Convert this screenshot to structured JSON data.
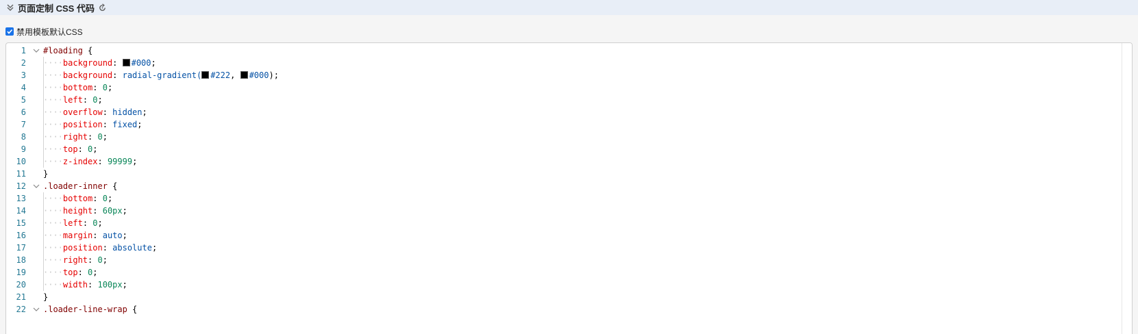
{
  "header": {
    "title": "页面定制 CSS 代码"
  },
  "options": {
    "disable_template_css_label": "禁用模板默认CSS",
    "disable_template_css_checked": true
  },
  "editor": {
    "lines": [
      {
        "n": "1",
        "fold": true,
        "indent": false,
        "tokens": [
          {
            "t": "#loading",
            "c": "sel"
          },
          {
            "t": " {",
            "c": "brace"
          }
        ]
      },
      {
        "n": "2",
        "fold": false,
        "indent": true,
        "tokens": [
          {
            "t": "background",
            "c": "prop"
          },
          {
            "t": ": ",
            "c": "punct"
          },
          {
            "t": "",
            "c": "swatch"
          },
          {
            "t": "#000",
            "c": "val-kw"
          },
          {
            "t": ";",
            "c": "punct"
          }
        ]
      },
      {
        "n": "3",
        "fold": false,
        "indent": true,
        "tokens": [
          {
            "t": "background",
            "c": "prop"
          },
          {
            "t": ": ",
            "c": "punct"
          },
          {
            "t": "radial-gradient(",
            "c": "val-kw"
          },
          {
            "t": "",
            "c": "swatch"
          },
          {
            "t": "#222",
            "c": "val-kw"
          },
          {
            "t": ", ",
            "c": "punct"
          },
          {
            "t": "",
            "c": "swatch"
          },
          {
            "t": "#000",
            "c": "val-kw"
          },
          {
            "t": ");",
            "c": "punct"
          }
        ]
      },
      {
        "n": "4",
        "fold": false,
        "indent": true,
        "tokens": [
          {
            "t": "bottom",
            "c": "prop"
          },
          {
            "t": ": ",
            "c": "punct"
          },
          {
            "t": "0",
            "c": "val-num"
          },
          {
            "t": ";",
            "c": "punct"
          }
        ]
      },
      {
        "n": "5",
        "fold": false,
        "indent": true,
        "tokens": [
          {
            "t": "left",
            "c": "prop"
          },
          {
            "t": ": ",
            "c": "punct"
          },
          {
            "t": "0",
            "c": "val-num"
          },
          {
            "t": ";",
            "c": "punct"
          }
        ]
      },
      {
        "n": "6",
        "fold": false,
        "indent": true,
        "tokens": [
          {
            "t": "overflow",
            "c": "prop"
          },
          {
            "t": ": ",
            "c": "punct"
          },
          {
            "t": "hidden",
            "c": "val-kw"
          },
          {
            "t": ";",
            "c": "punct"
          }
        ]
      },
      {
        "n": "7",
        "fold": false,
        "indent": true,
        "tokens": [
          {
            "t": "position",
            "c": "prop"
          },
          {
            "t": ": ",
            "c": "punct"
          },
          {
            "t": "fixed",
            "c": "val-kw"
          },
          {
            "t": ";",
            "c": "punct"
          }
        ]
      },
      {
        "n": "8",
        "fold": false,
        "indent": true,
        "tokens": [
          {
            "t": "right",
            "c": "prop"
          },
          {
            "t": ": ",
            "c": "punct"
          },
          {
            "t": "0",
            "c": "val-num"
          },
          {
            "t": ";",
            "c": "punct"
          }
        ]
      },
      {
        "n": "9",
        "fold": false,
        "indent": true,
        "tokens": [
          {
            "t": "top",
            "c": "prop"
          },
          {
            "t": ": ",
            "c": "punct"
          },
          {
            "t": "0",
            "c": "val-num"
          },
          {
            "t": ";",
            "c": "punct"
          }
        ]
      },
      {
        "n": "10",
        "fold": false,
        "indent": true,
        "tokens": [
          {
            "t": "z-index",
            "c": "prop"
          },
          {
            "t": ": ",
            "c": "punct"
          },
          {
            "t": "99999",
            "c": "val-num"
          },
          {
            "t": ";",
            "c": "punct"
          }
        ]
      },
      {
        "n": "11",
        "fold": false,
        "indent": false,
        "tokens": [
          {
            "t": "}",
            "c": "brace"
          }
        ]
      },
      {
        "n": "12",
        "fold": true,
        "indent": false,
        "tokens": [
          {
            "t": ".loader-inner",
            "c": "sel"
          },
          {
            "t": " {",
            "c": "brace"
          }
        ]
      },
      {
        "n": "13",
        "fold": false,
        "indent": true,
        "tokens": [
          {
            "t": "bottom",
            "c": "prop"
          },
          {
            "t": ": ",
            "c": "punct"
          },
          {
            "t": "0",
            "c": "val-num"
          },
          {
            "t": ";",
            "c": "punct"
          }
        ]
      },
      {
        "n": "14",
        "fold": false,
        "indent": true,
        "tokens": [
          {
            "t": "height",
            "c": "prop"
          },
          {
            "t": ": ",
            "c": "punct"
          },
          {
            "t": "60px",
            "c": "val-num"
          },
          {
            "t": ";",
            "c": "punct"
          }
        ]
      },
      {
        "n": "15",
        "fold": false,
        "indent": true,
        "tokens": [
          {
            "t": "left",
            "c": "prop"
          },
          {
            "t": ": ",
            "c": "punct"
          },
          {
            "t": "0",
            "c": "val-num"
          },
          {
            "t": ";",
            "c": "punct"
          }
        ]
      },
      {
        "n": "16",
        "fold": false,
        "indent": true,
        "tokens": [
          {
            "t": "margin",
            "c": "prop"
          },
          {
            "t": ": ",
            "c": "punct"
          },
          {
            "t": "auto",
            "c": "val-kw"
          },
          {
            "t": ";",
            "c": "punct"
          }
        ]
      },
      {
        "n": "17",
        "fold": false,
        "indent": true,
        "tokens": [
          {
            "t": "position",
            "c": "prop"
          },
          {
            "t": ": ",
            "c": "punct"
          },
          {
            "t": "absolute",
            "c": "val-kw"
          },
          {
            "t": ";",
            "c": "punct"
          }
        ]
      },
      {
        "n": "18",
        "fold": false,
        "indent": true,
        "tokens": [
          {
            "t": "right",
            "c": "prop"
          },
          {
            "t": ": ",
            "c": "punct"
          },
          {
            "t": "0",
            "c": "val-num"
          },
          {
            "t": ";",
            "c": "punct"
          }
        ]
      },
      {
        "n": "19",
        "fold": false,
        "indent": true,
        "tokens": [
          {
            "t": "top",
            "c": "prop"
          },
          {
            "t": ": ",
            "c": "punct"
          },
          {
            "t": "0",
            "c": "val-num"
          },
          {
            "t": ";",
            "c": "punct"
          }
        ]
      },
      {
        "n": "20",
        "fold": false,
        "indent": true,
        "tokens": [
          {
            "t": "width",
            "c": "prop"
          },
          {
            "t": ": ",
            "c": "punct"
          },
          {
            "t": "100px",
            "c": "val-num"
          },
          {
            "t": ";",
            "c": "punct"
          }
        ]
      },
      {
        "n": "21",
        "fold": false,
        "indent": false,
        "tokens": [
          {
            "t": "}",
            "c": "brace"
          }
        ]
      },
      {
        "n": "22",
        "fold": true,
        "indent": false,
        "tokens": [
          {
            "t": ".loader-line-wrap",
            "c": "sel"
          },
          {
            "t": " {",
            "c": "brace"
          }
        ]
      }
    ]
  }
}
